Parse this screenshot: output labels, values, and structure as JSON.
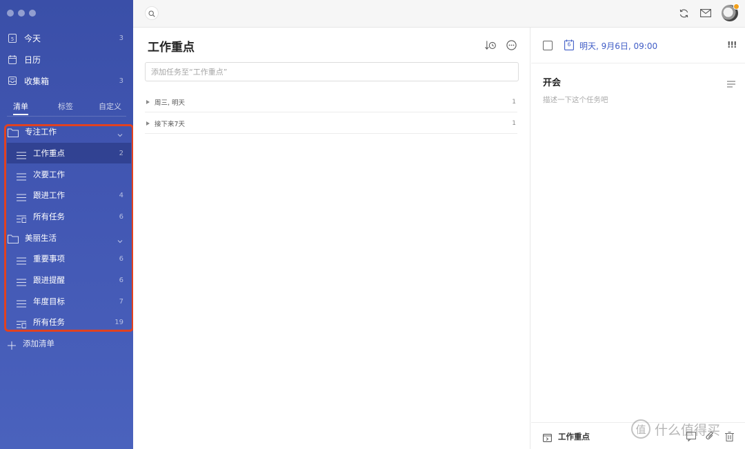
{
  "sidebar": {
    "nav": [
      {
        "label": "今天",
        "count": "3",
        "icon": "today-icon"
      },
      {
        "label": "日历",
        "count": "",
        "icon": "calendar-icon"
      },
      {
        "label": "收集箱",
        "count": "3",
        "icon": "inbox-icon"
      }
    ],
    "tabs": [
      "清单",
      "标签",
      "自定义"
    ],
    "folders": [
      {
        "label": "专注工作",
        "items": [
          {
            "label": "工作重点",
            "count": "2",
            "active": true
          },
          {
            "label": "次要工作",
            "count": ""
          },
          {
            "label": "跟进工作",
            "count": "4"
          },
          {
            "label": "所有任务",
            "count": "6"
          }
        ]
      },
      {
        "label": "美丽生活",
        "items": [
          {
            "label": "重要事项",
            "count": "6"
          },
          {
            "label": "跟进提醒",
            "count": "6"
          },
          {
            "label": "年度目标",
            "count": "7"
          },
          {
            "label": "所有任务",
            "count": "19"
          }
        ]
      }
    ],
    "add_list": "添加清单"
  },
  "main": {
    "title": "工作重点",
    "add_task_placeholder": "添加任务至“工作重点”",
    "groups": [
      {
        "label": "周三, 明天",
        "count": "1"
      },
      {
        "label": "接下来7天",
        "count": "1"
      }
    ]
  },
  "detail": {
    "date": "明天, 9月6日, 09:00",
    "calendar_day": "6",
    "priority": "!!!",
    "title": "开会",
    "description_placeholder": "描述一下这个任务吧",
    "list_name": "工作重点"
  },
  "watermark": {
    "logo": "值",
    "text": "什么值得买"
  },
  "colors": {
    "sidebar": "#4257b3",
    "accent": "#3f5cc6",
    "highlight": "#e2411f"
  }
}
